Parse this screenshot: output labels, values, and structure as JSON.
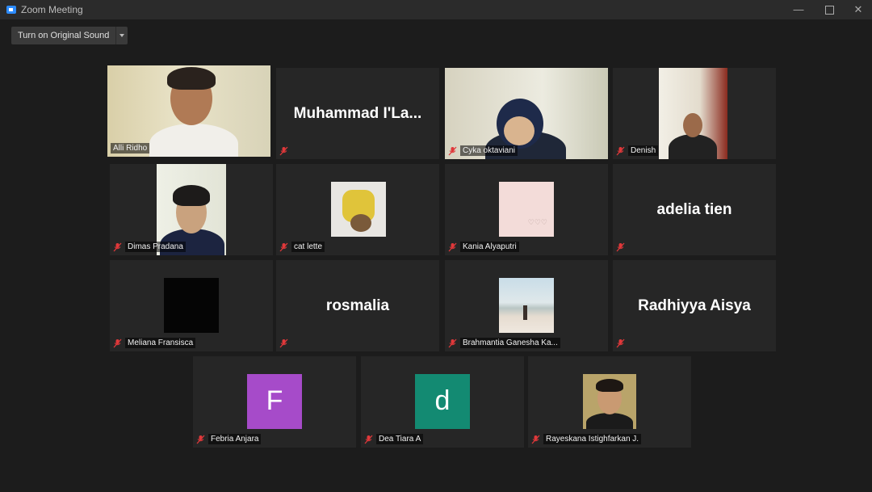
{
  "window": {
    "title": "Zoom Meeting"
  },
  "toolbar": {
    "original_sound_label": "Turn on Original Sound"
  },
  "participants": [
    {
      "name": "Alli Ridho"
    },
    {
      "name": "Muhammad  I'La...",
      "display": "Muhammad  I'La..."
    },
    {
      "name": "Cyka oktaviani"
    },
    {
      "name": "Denish"
    },
    {
      "name": "Dimas Pradana"
    },
    {
      "name": "cat lette"
    },
    {
      "name": "Kania Alyaputri",
      "picture_text": "♡♡♡"
    },
    {
      "name": "adelia tien",
      "display": "adelia tien"
    },
    {
      "name": "Meliana Fransisca"
    },
    {
      "name": "rosmalia",
      "display": "rosmalia"
    },
    {
      "name": "Brahmantia Ganesha Ka..."
    },
    {
      "name": "Radhiyya Aisya",
      "display": "Radhiyya Aisya"
    },
    {
      "name": "Febria Anjara",
      "avatar_letter": "F",
      "avatar_color": "#a64bc9"
    },
    {
      "name": "Dea Tiara A",
      "avatar_letter": "d",
      "avatar_color": "#138a72"
    },
    {
      "name": "Rayeskana Istighfarkan J."
    }
  ],
  "colors": {
    "active_speaker": "#c6e74a",
    "mic_muted": "#e0383a",
    "tile": "#262626"
  }
}
